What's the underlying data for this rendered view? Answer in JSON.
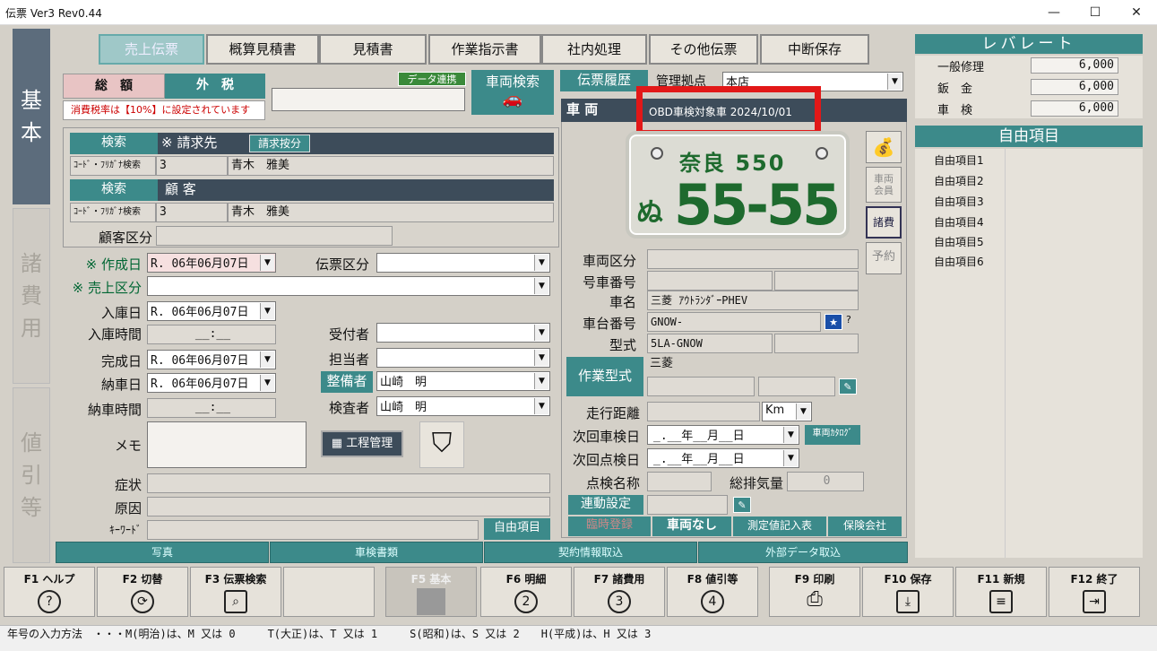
{
  "window": {
    "title": "伝票 Ver3 Rev0.44",
    "min": "—",
    "max": "☐",
    "close": "✕"
  },
  "sidetabs": {
    "kihon": "基\n本",
    "shohiyo": "諸\n費\n用",
    "nebiki": "値\n引\n等"
  },
  "toptabs": [
    "売上伝票",
    "概算見積書",
    "見積書",
    "作業指示書",
    "社内処理",
    "その他伝票",
    "中断保存"
  ],
  "total": {
    "label": "総　額",
    "tax_label": "外　税",
    "tax_note": "消費税率は【10%】に設定されています",
    "data_link": "データ連携",
    "vehicle_search": "車両検索",
    "history": "伝票履歴",
    "base_label": "管理拠点",
    "base_value": "本店"
  },
  "customer": {
    "search1": "検索",
    "billto_label": "※ 請求先",
    "billto_btn": "請求按分",
    "kana_label": "ｺｰﾄﾞ・ﾌﾘｶﾞﾅ検索",
    "code1": "3",
    "name1": "青木　雅美",
    "search2": "検索",
    "cust_label": "顧 客",
    "code2": "3",
    "name2": "青木　雅美",
    "class_label": "顧客区分"
  },
  "form": {
    "created_label": "※ 作成日",
    "created": "R. 06年06月07日",
    "slip_type": "伝票区分",
    "sales_label": "※ 売上区分",
    "in_date_label": "入庫日",
    "in_date": "R. 06年06月07日",
    "in_time_label": "入庫時間",
    "in_time": "__:__",
    "receiver": "受付者",
    "done_label": "完成日",
    "done": "R. 06年06月07日",
    "staff": "担当者",
    "deliv_label": "納車日",
    "deliv": "R. 06年06月07日",
    "mechanic_btn": "整備者",
    "mechanic": "山崎　明",
    "deliv_time_label": "納車時間",
    "deliv_time": "__:__",
    "inspector": "検査者",
    "inspector_v": "山崎　明",
    "memo": "メモ",
    "schedule": "工程管理",
    "symptom": "症状",
    "cause": "原因",
    "keyword": "ｷｰﾜｰﾄﾞ",
    "free_item": "自由項目"
  },
  "vehicle": {
    "title": "車 両",
    "obd": "OBD車検対象車 2024/10/01",
    "plate_region": "奈良 550",
    "plate_kana": "ぬ",
    "plate_num": "55-55",
    "class_label": "車両区分",
    "unit_label": "号車番号",
    "name_label": "車名",
    "name": "三菱 ｱｳﾄﾗﾝﾀﾞｰPHEV",
    "chassis_label": "車台番号",
    "chassis": "GNOW-",
    "model_label": "型式",
    "model": "5LA-GNOW",
    "work_model_btn": "作業型式",
    "maker": "三菱",
    "mileage_label": "走行距離",
    "mileage_unit": "Km",
    "next_insp_label": "次回車検日",
    "next_insp": "_.__年__月__日",
    "catalog": "車両ｶﾀﾛｸﾞ",
    "next_check_label": "次回点検日",
    "next_check": "_.__年__月__日",
    "check_name": "点検名称",
    "displacement": "総排気量",
    "displacement_v": "0",
    "link_btn": "連動設定",
    "temp_reg": "臨時登録",
    "no_vehicle": "車両なし",
    "measure": "測定値記入表",
    "insurance": "保険会社",
    "side1": "車両\n会員",
    "side2": "諸費",
    "side3": "予約"
  },
  "bottom_tabs": [
    "写真",
    "車検書類",
    "契約情報取込",
    "外部データ取込"
  ],
  "rate": {
    "title": "レバレート",
    "rows": [
      {
        "label": "一般修理",
        "value": "6,000"
      },
      {
        "label": "鈑　金",
        "value": "6,000"
      },
      {
        "label": "車　検",
        "value": "6,000"
      }
    ]
  },
  "free": {
    "title": "自由項目",
    "items": [
      "自由項目1",
      "自由項目2",
      "自由項目3",
      "自由項目4",
      "自由項目5",
      "自由項目6"
    ]
  },
  "fkeys": [
    {
      "k": "F1 ヘルプ",
      "i": "?"
    },
    {
      "k": "F2 切替",
      "i": "⟳"
    },
    {
      "k": "F3 伝票検索",
      "i": "⌕"
    },
    {
      "k": "",
      "i": ""
    },
    {
      "k": "F5 基本",
      "i": ""
    },
    {
      "k": "F6 明細",
      "i": "2"
    },
    {
      "k": "F7 諸費用",
      "i": "3"
    },
    {
      "k": "F8 値引等",
      "i": "4"
    },
    {
      "k": "F9 印刷",
      "i": "⎙"
    },
    {
      "k": "F10 保存",
      "i": "⤓"
    },
    {
      "k": "F11 新規",
      "i": "≡"
    },
    {
      "k": "F12 終了",
      "i": "⇥"
    }
  ],
  "status": "年号の入力方法　・・・M(明治)は、M 又は 0　　　T(大正)は、T 又は 1　　　S(昭和)は、S 又は 2　　H(平成)は、H 又は 3"
}
